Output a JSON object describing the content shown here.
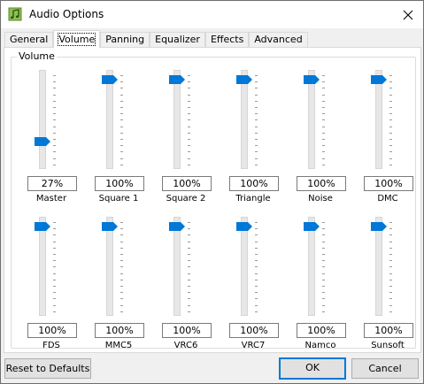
{
  "window": {
    "title": "Audio Options",
    "app_icon": "music-note-icon",
    "accent": "#0078d7"
  },
  "tabs": [
    {
      "label": "General",
      "active": false
    },
    {
      "label": "Volume",
      "active": true
    },
    {
      "label": "Panning",
      "active": false
    },
    {
      "label": "Equalizer",
      "active": false
    },
    {
      "label": "Effects",
      "active": false
    },
    {
      "label": "Advanced",
      "active": false
    }
  ],
  "group": {
    "label": "Volume"
  },
  "channels": [
    {
      "label": "Master",
      "value_text": "27%",
      "level": 0.27
    },
    {
      "label": "Square 1",
      "value_text": "100%",
      "level": 1.0
    },
    {
      "label": "Square 2",
      "value_text": "100%",
      "level": 1.0
    },
    {
      "label": "Triangle",
      "value_text": "100%",
      "level": 1.0
    },
    {
      "label": "Noise",
      "value_text": "100%",
      "level": 1.0
    },
    {
      "label": "DMC",
      "value_text": "100%",
      "level": 1.0
    },
    {
      "label": "FDS",
      "value_text": "100%",
      "level": 1.0
    },
    {
      "label": "MMC5",
      "value_text": "100%",
      "level": 1.0
    },
    {
      "label": "VRC6",
      "value_text": "100%",
      "level": 1.0
    },
    {
      "label": "VRC7",
      "value_text": "100%",
      "level": 1.0
    },
    {
      "label": "Namco",
      "value_text": "100%",
      "level": 1.0
    },
    {
      "label": "Sunsoft",
      "value_text": "100%",
      "level": 1.0
    }
  ],
  "buttons": {
    "reset": "Reset to Defaults",
    "ok": "OK",
    "cancel": "Cancel"
  }
}
